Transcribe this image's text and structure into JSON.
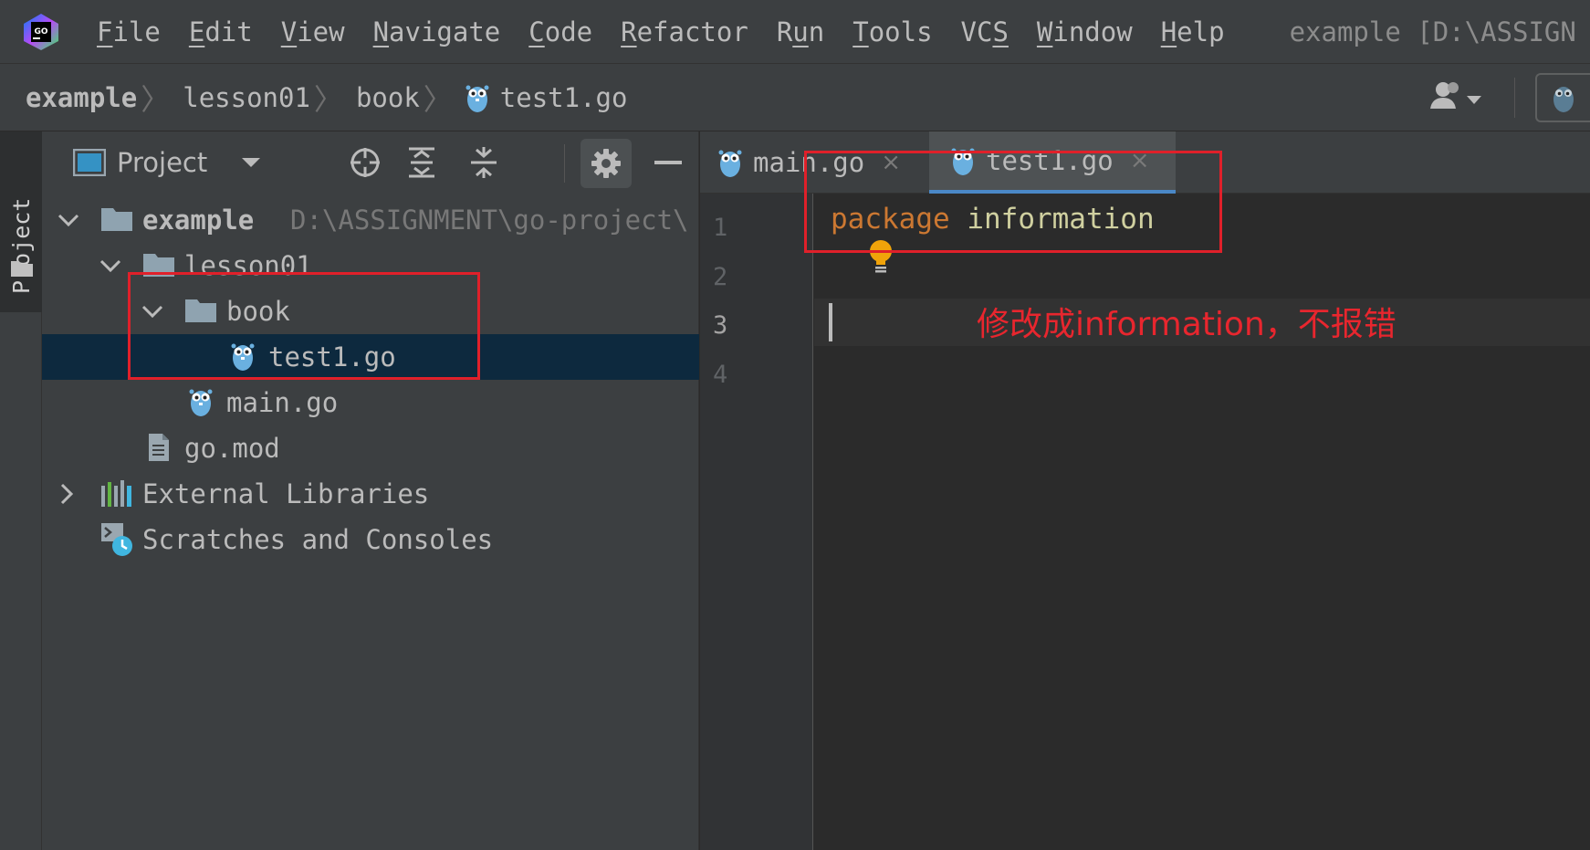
{
  "menubar": {
    "items": [
      {
        "mnemonic": "F",
        "rest": "ile"
      },
      {
        "mnemonic": "E",
        "rest": "dit"
      },
      {
        "mnemonic": "V",
        "rest": "iew"
      },
      {
        "mnemonic": "N",
        "rest": "avigate"
      },
      {
        "mnemonic": "C",
        "rest": "ode"
      },
      {
        "mnemonic": "R",
        "rest": "efactor"
      },
      {
        "pre": "R",
        "mnemonic": "u",
        "rest": "n"
      },
      {
        "mnemonic": "T",
        "rest": "ools"
      },
      {
        "pre": "VC",
        "mnemonic": "S",
        "rest": ""
      },
      {
        "mnemonic": "W",
        "rest": "indow"
      },
      {
        "mnemonic": "H",
        "rest": "elp"
      }
    ],
    "window_title": "example [D:\\ASSIGN"
  },
  "breadcrumb": [
    "example",
    "lesson01",
    "book",
    "test1.go"
  ],
  "tool_stripe": {
    "label": "Project"
  },
  "project_panel": {
    "title": "Project",
    "tree": [
      {
        "label": "example",
        "path": "D:\\ASSIGNMENT\\go-project\\"
      },
      {
        "label": "lesson01"
      },
      {
        "label": "book"
      },
      {
        "label": "test1.go"
      },
      {
        "label": "main.go"
      },
      {
        "label": "go.mod"
      },
      {
        "label": "External Libraries"
      },
      {
        "label": "Scratches and Consoles"
      }
    ]
  },
  "editor": {
    "tabs": [
      {
        "label": "main.go",
        "close": "×"
      },
      {
        "label": "test1.go",
        "close": "×"
      }
    ],
    "line_numbers": [
      "1",
      "2",
      "3",
      "4"
    ],
    "code": {
      "keyword": "package",
      "identifier": "information"
    }
  },
  "annotation": {
    "text": "修改成information，不报错"
  },
  "colors": {
    "accent": "#4a88c7",
    "selection": "#0d293e",
    "annotation": "#e0202a",
    "keyword": "#cc7832"
  }
}
